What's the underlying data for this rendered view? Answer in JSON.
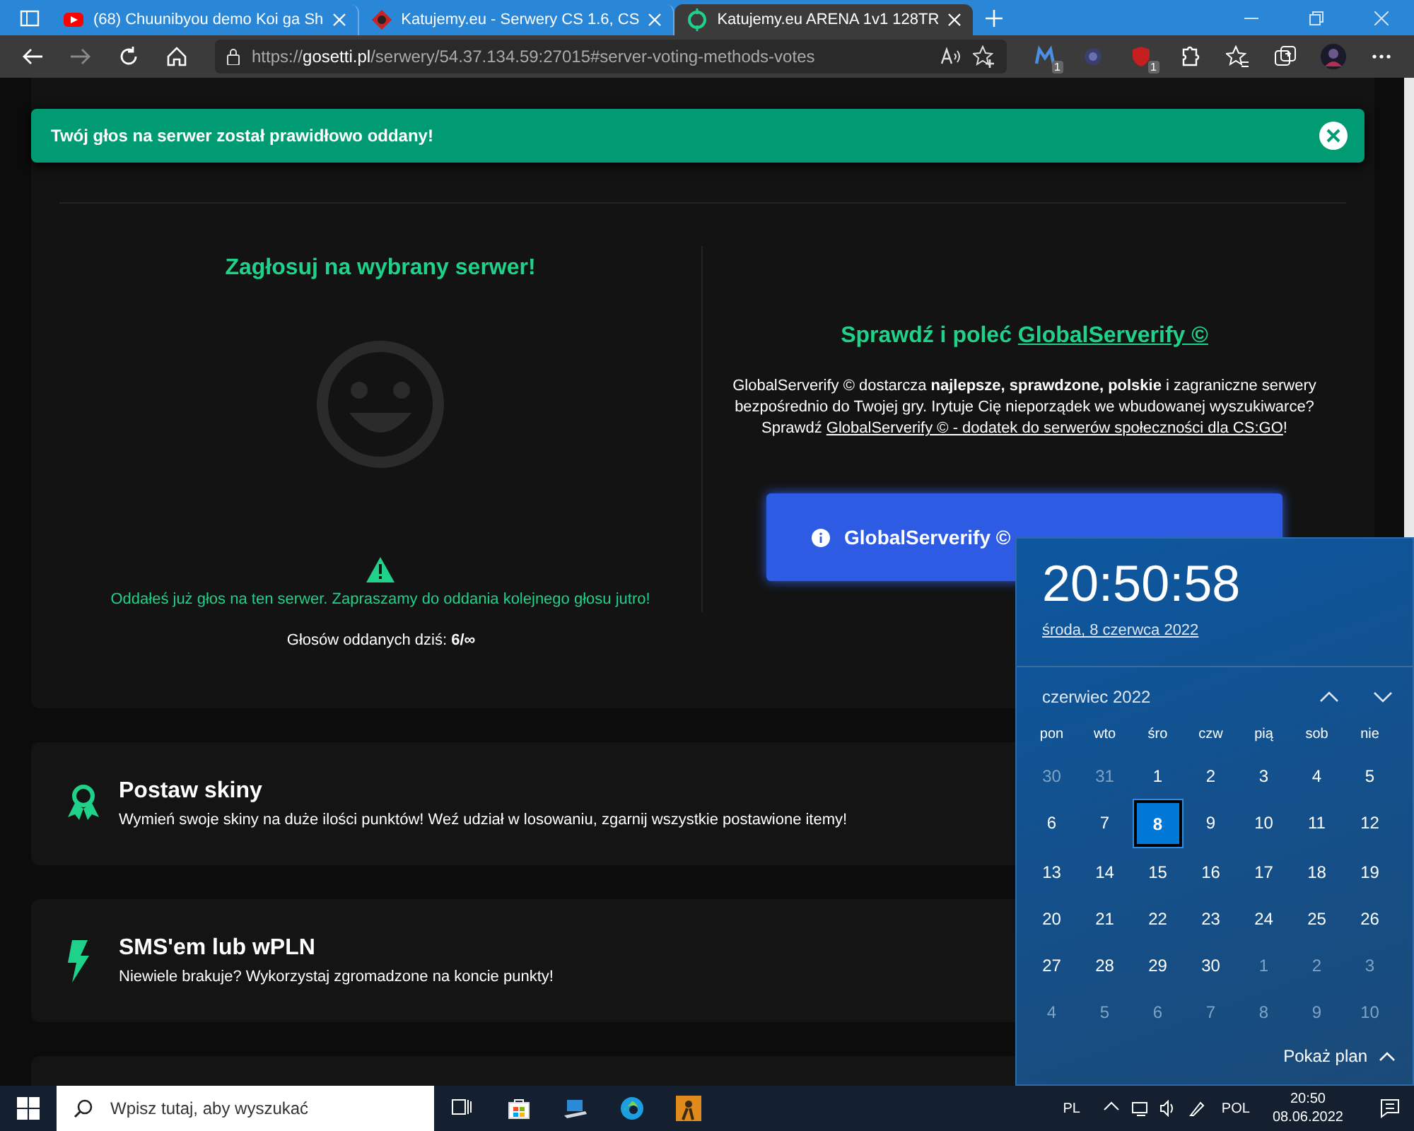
{
  "browser": {
    "tabs": [
      {
        "title": "(68) Chuunibyou demo Koi ga Sh",
        "selected": false
      },
      {
        "title": "Katujemy.eu - Serwery CS 1.6, CS",
        "selected": false
      },
      {
        "title": "Katujemy.eu ARENA 1v1 128TR",
        "selected": true
      }
    ],
    "address": "https://**gosetti.pl**/serwery/54.37.134.59:27015#server-voting-methods-votes",
    "extension_badges": [
      "1",
      "1"
    ],
    "forward_disabled": true
  },
  "toast": {
    "text": "Twój głos na serwer został prawidłowo oddany!"
  },
  "vote": {
    "title": "Zagłosuj na wybrany serwer!",
    "info": "Oddałeś już głos na ten serwer. Zapraszamy do oddania kolejnego głosu jutro!",
    "votes": "Głosów oddanych dziś: **6/∞**"
  },
  "promo": {
    "title": "Sprawdź i poleć ",
    "title_link": "GlobalServerify ©",
    "text": "GlobalServerify © dostarcza **najlepsze, sprawdzone, polskie** i zagraniczne serwery bezpośrednio do Twojej gry. Irytuje Cię nieporządek we wbudowanej wyszukiwarce? Sprawdź ",
    "text_link": "GlobalServerify © - dodatek do serwerów społeczności dla CS:GO",
    "text_end": "!",
    "button": "GlobalServerify ©"
  },
  "features": [
    {
      "kind": "ribbon",
      "title": "Postaw skiny",
      "description": "Wymień swoje skiny na duże ilości punktów! Weź udział w losowaniu, zgarnij wszystkie postawione itemy!"
    },
    {
      "kind": "bolt",
      "title": "SMS'em lub wPLN",
      "description": "Niewiele brakuje? Wykorzystaj zgromadzone na koncie punkty!"
    }
  ],
  "calendar": {
    "time": "20:50:58",
    "date": "środa, 8 czerwca 2022",
    "month": "czerwiec 2022",
    "weekdays": [
      "pon",
      "wto",
      "śro",
      "czw",
      "pią",
      "sob",
      "nie"
    ],
    "weeks": [
      [
        {
          "day": "30",
          "muted": true,
          "selected": false
        },
        {
          "day": "31",
          "muted": true,
          "selected": false
        },
        {
          "day": "1",
          "muted": false,
          "selected": false
        },
        {
          "day": "2",
          "muted": false,
          "selected": false
        },
        {
          "day": "3",
          "muted": false,
          "selected": false
        },
        {
          "day": "4",
          "muted": false,
          "selected": false
        },
        {
          "day": "5",
          "muted": false,
          "selected": false
        }
      ],
      [
        {
          "day": "6",
          "muted": false,
          "selected": false
        },
        {
          "day": "7",
          "muted": false,
          "selected": false
        },
        {
          "day": "8",
          "muted": false,
          "selected": true
        },
        {
          "day": "9",
          "muted": false,
          "selected": false
        },
        {
          "day": "10",
          "muted": false,
          "selected": false
        },
        {
          "day": "11",
          "muted": false,
          "selected": false
        },
        {
          "day": "12",
          "muted": false,
          "selected": false
        }
      ],
      [
        {
          "day": "13",
          "muted": false,
          "selected": false
        },
        {
          "day": "14",
          "muted": false,
          "selected": false
        },
        {
          "day": "15",
          "muted": false,
          "selected": false
        },
        {
          "day": "16",
          "muted": false,
          "selected": false
        },
        {
          "day": "17",
          "muted": false,
          "selected": false
        },
        {
          "day": "18",
          "muted": false,
          "selected": false
        },
        {
          "day": "19",
          "muted": false,
          "selected": false
        }
      ],
      [
        {
          "day": "20",
          "muted": false,
          "selected": false
        },
        {
          "day": "21",
          "muted": false,
          "selected": false
        },
        {
          "day": "22",
          "muted": false,
          "selected": false
        },
        {
          "day": "23",
          "muted": false,
          "selected": false
        },
        {
          "day": "24",
          "muted": false,
          "selected": false
        },
        {
          "day": "25",
          "muted": false,
          "selected": false
        },
        {
          "day": "26",
          "muted": false,
          "selected": false
        }
      ],
      [
        {
          "day": "27",
          "muted": false,
          "selected": false
        },
        {
          "day": "28",
          "muted": false,
          "selected": false
        },
        {
          "day": "29",
          "muted": false,
          "selected": false
        },
        {
          "day": "30",
          "muted": false,
          "selected": false
        },
        {
          "day": "1",
          "muted": true,
          "selected": false
        },
        {
          "day": "2",
          "muted": true,
          "selected": false
        },
        {
          "day": "3",
          "muted": true,
          "selected": false
        }
      ],
      [
        {
          "day": "4",
          "muted": true,
          "selected": false
        },
        {
          "day": "5",
          "muted": true,
          "selected": false
        },
        {
          "day": "6",
          "muted": true,
          "selected": false
        },
        {
          "day": "7",
          "muted": true,
          "selected": false
        },
        {
          "day": "8",
          "muted": true,
          "selected": false
        },
        {
          "day": "9",
          "muted": true,
          "selected": false
        },
        {
          "day": "10",
          "muted": true,
          "selected": false
        }
      ]
    ],
    "agenda_toggle": "Pokaż plan"
  },
  "taskbar": {
    "search_placeholder": "Wpisz tutaj, aby wyszukać",
    "keyboard": "PL",
    "language": "POL",
    "time": "20:50",
    "date": "08.06.2022"
  }
}
